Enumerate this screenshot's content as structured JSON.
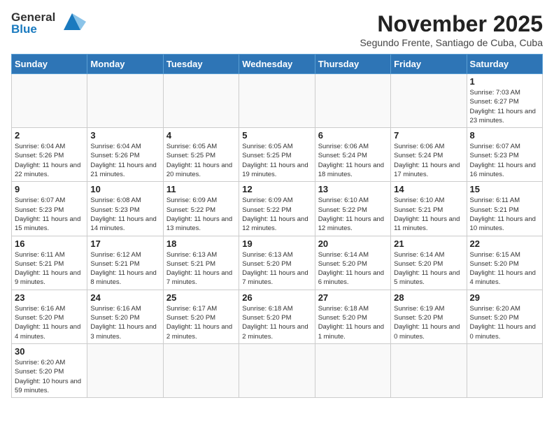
{
  "header": {
    "logo_line1": "General",
    "logo_line2": "Blue",
    "month_title": "November 2025",
    "subtitle": "Segundo Frente, Santiago de Cuba, Cuba"
  },
  "weekdays": [
    "Sunday",
    "Monday",
    "Tuesday",
    "Wednesday",
    "Thursday",
    "Friday",
    "Saturday"
  ],
  "days": [
    {
      "num": "",
      "info": ""
    },
    {
      "num": "",
      "info": ""
    },
    {
      "num": "",
      "info": ""
    },
    {
      "num": "",
      "info": ""
    },
    {
      "num": "",
      "info": ""
    },
    {
      "num": "",
      "info": ""
    },
    {
      "num": "1",
      "info": "Sunrise: 7:03 AM\nSunset: 6:27 PM\nDaylight: 11 hours\nand 23 minutes."
    },
    {
      "num": "2",
      "info": "Sunrise: 6:04 AM\nSunset: 5:26 PM\nDaylight: 11 hours\nand 22 minutes."
    },
    {
      "num": "3",
      "info": "Sunrise: 6:04 AM\nSunset: 5:26 PM\nDaylight: 11 hours\nand 21 minutes."
    },
    {
      "num": "4",
      "info": "Sunrise: 6:05 AM\nSunset: 5:25 PM\nDaylight: 11 hours\nand 20 minutes."
    },
    {
      "num": "5",
      "info": "Sunrise: 6:05 AM\nSunset: 5:25 PM\nDaylight: 11 hours\nand 19 minutes."
    },
    {
      "num": "6",
      "info": "Sunrise: 6:06 AM\nSunset: 5:24 PM\nDaylight: 11 hours\nand 18 minutes."
    },
    {
      "num": "7",
      "info": "Sunrise: 6:06 AM\nSunset: 5:24 PM\nDaylight: 11 hours\nand 17 minutes."
    },
    {
      "num": "8",
      "info": "Sunrise: 6:07 AM\nSunset: 5:23 PM\nDaylight: 11 hours\nand 16 minutes."
    },
    {
      "num": "9",
      "info": "Sunrise: 6:07 AM\nSunset: 5:23 PM\nDaylight: 11 hours\nand 15 minutes."
    },
    {
      "num": "10",
      "info": "Sunrise: 6:08 AM\nSunset: 5:23 PM\nDaylight: 11 hours\nand 14 minutes."
    },
    {
      "num": "11",
      "info": "Sunrise: 6:09 AM\nSunset: 5:22 PM\nDaylight: 11 hours\nand 13 minutes."
    },
    {
      "num": "12",
      "info": "Sunrise: 6:09 AM\nSunset: 5:22 PM\nDaylight: 11 hours\nand 12 minutes."
    },
    {
      "num": "13",
      "info": "Sunrise: 6:10 AM\nSunset: 5:22 PM\nDaylight: 11 hours\nand 12 minutes."
    },
    {
      "num": "14",
      "info": "Sunrise: 6:10 AM\nSunset: 5:21 PM\nDaylight: 11 hours\nand 11 minutes."
    },
    {
      "num": "15",
      "info": "Sunrise: 6:11 AM\nSunset: 5:21 PM\nDaylight: 11 hours\nand 10 minutes."
    },
    {
      "num": "16",
      "info": "Sunrise: 6:11 AM\nSunset: 5:21 PM\nDaylight: 11 hours\nand 9 minutes."
    },
    {
      "num": "17",
      "info": "Sunrise: 6:12 AM\nSunset: 5:21 PM\nDaylight: 11 hours\nand 8 minutes."
    },
    {
      "num": "18",
      "info": "Sunrise: 6:13 AM\nSunset: 5:21 PM\nDaylight: 11 hours\nand 7 minutes."
    },
    {
      "num": "19",
      "info": "Sunrise: 6:13 AM\nSunset: 5:20 PM\nDaylight: 11 hours\nand 7 minutes."
    },
    {
      "num": "20",
      "info": "Sunrise: 6:14 AM\nSunset: 5:20 PM\nDaylight: 11 hours\nand 6 minutes."
    },
    {
      "num": "21",
      "info": "Sunrise: 6:14 AM\nSunset: 5:20 PM\nDaylight: 11 hours\nand 5 minutes."
    },
    {
      "num": "22",
      "info": "Sunrise: 6:15 AM\nSunset: 5:20 PM\nDaylight: 11 hours\nand 4 minutes."
    },
    {
      "num": "23",
      "info": "Sunrise: 6:16 AM\nSunset: 5:20 PM\nDaylight: 11 hours\nand 4 minutes."
    },
    {
      "num": "24",
      "info": "Sunrise: 6:16 AM\nSunset: 5:20 PM\nDaylight: 11 hours\nand 3 minutes."
    },
    {
      "num": "25",
      "info": "Sunrise: 6:17 AM\nSunset: 5:20 PM\nDaylight: 11 hours\nand 2 minutes."
    },
    {
      "num": "26",
      "info": "Sunrise: 6:18 AM\nSunset: 5:20 PM\nDaylight: 11 hours\nand 2 minutes."
    },
    {
      "num": "27",
      "info": "Sunrise: 6:18 AM\nSunset: 5:20 PM\nDaylight: 11 hours\nand 1 minute."
    },
    {
      "num": "28",
      "info": "Sunrise: 6:19 AM\nSunset: 5:20 PM\nDaylight: 11 hours\nand 0 minutes."
    },
    {
      "num": "29",
      "info": "Sunrise: 6:20 AM\nSunset: 5:20 PM\nDaylight: 11 hours\nand 0 minutes."
    },
    {
      "num": "30",
      "info": "Sunrise: 6:20 AM\nSunset: 5:20 PM\nDaylight: 10 hours\nand 59 minutes."
    },
    {
      "num": "",
      "info": ""
    },
    {
      "num": "",
      "info": ""
    },
    {
      "num": "",
      "info": ""
    },
    {
      "num": "",
      "info": ""
    },
    {
      "num": "",
      "info": ""
    },
    {
      "num": "",
      "info": ""
    }
  ]
}
